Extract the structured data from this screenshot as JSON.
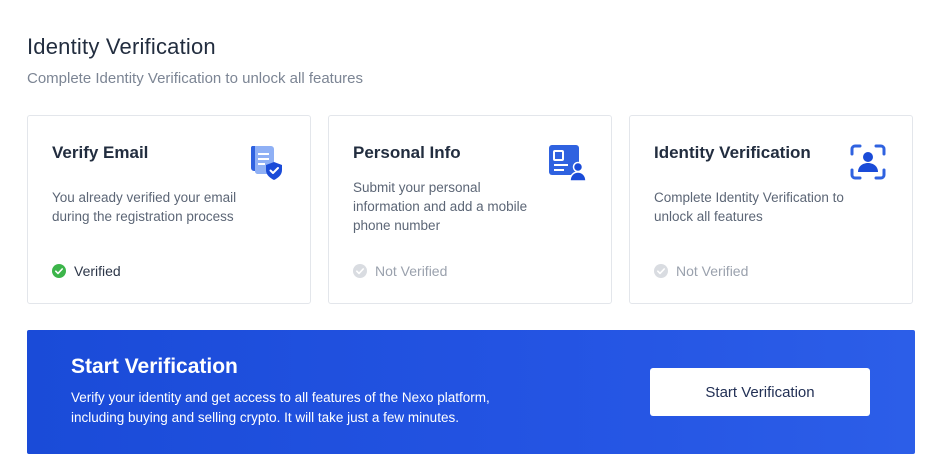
{
  "header": {
    "title": "Identity Verification",
    "subtitle": "Complete Identity Verification to unlock all features"
  },
  "cards": [
    {
      "title": "Verify Email",
      "description": "You already verified your email during the registration process",
      "status": "Verified",
      "icon": "email-shield-icon"
    },
    {
      "title": "Personal Info",
      "description": "Submit your personal information and add a mobile phone number",
      "status": "Not Verified",
      "icon": "id-card-icon"
    },
    {
      "title": "Identity Verification",
      "description": "Complete Identity Verification to unlock all features",
      "status": "Not Verified",
      "icon": "face-scan-icon"
    }
  ],
  "banner": {
    "title": "Start Verification",
    "text": "Verify your identity and get access to all features of the Nexo platform, including buying and selling crypto. It will take just a few minutes.",
    "button_label": "Start Verification"
  },
  "colors": {
    "accent": "#1a4bd8",
    "verified": "#3cb54a",
    "not_verified": "#d9dce1"
  }
}
